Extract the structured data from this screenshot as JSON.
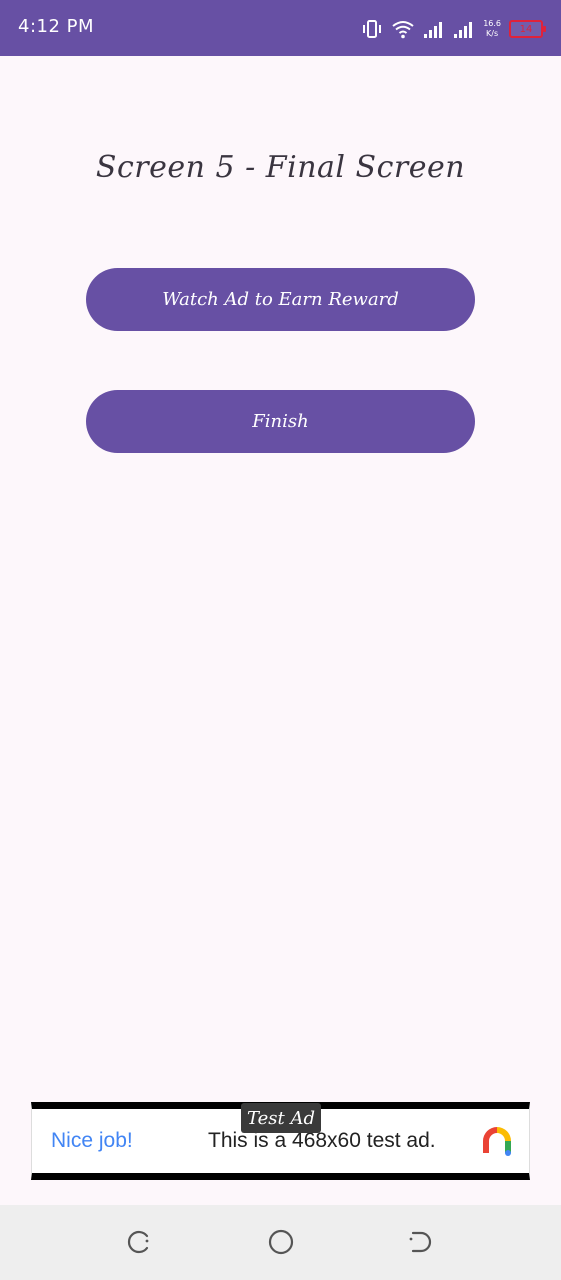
{
  "status_bar": {
    "time": "4:12 PM",
    "network_speed_value": "16.6",
    "network_speed_unit": "K/s",
    "battery_level": "14",
    "color": "#6750a4"
  },
  "screen": {
    "title": "Screen 5 - Final Screen"
  },
  "buttons": {
    "watch_ad_label": "Watch Ad to Earn Reward",
    "finish_label": "Finish",
    "color": "#6750a4"
  },
  "ad_banner": {
    "badge": "Test Ad",
    "headline": "Nice job!",
    "text": "This is a 468x60 test ad.",
    "headline_color": "#4285f4",
    "logo_icon": "admob-logo-icon"
  },
  "nav_bar": {
    "icons": [
      "recent-apps-icon",
      "home-icon",
      "back-icon"
    ]
  }
}
